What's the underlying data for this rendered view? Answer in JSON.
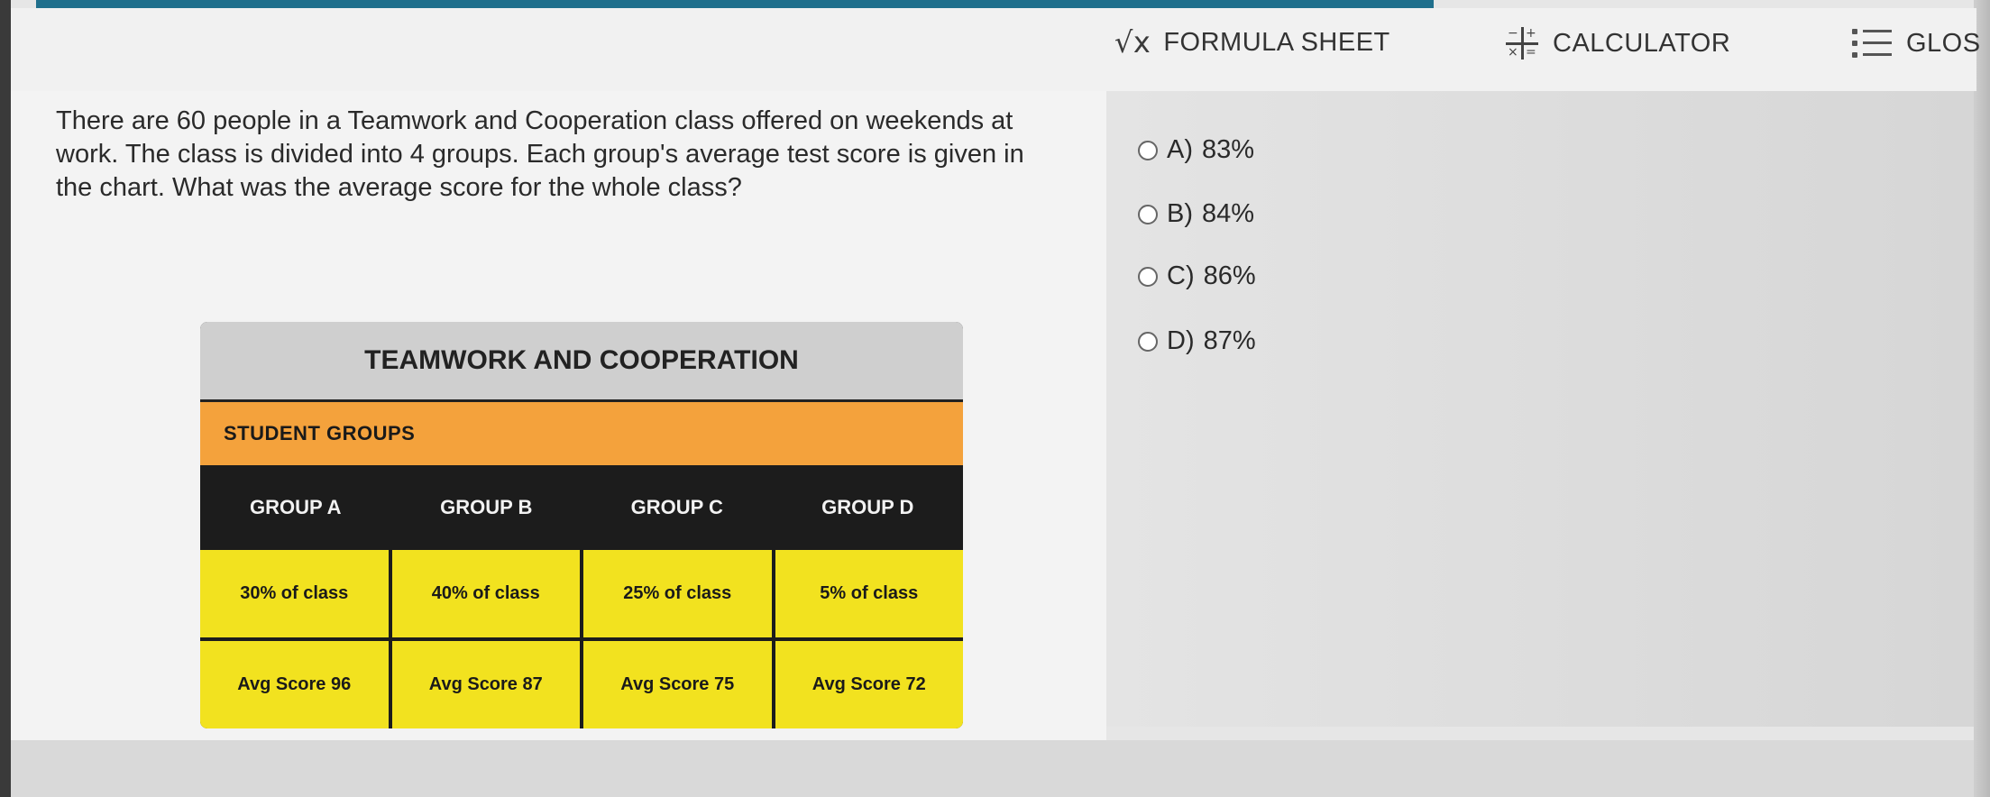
{
  "toolbar": {
    "formula_label": "FORMULA SHEET",
    "calculator_label": "CALCULATOR",
    "glossary_label": "GLOS",
    "formula_icon_glyph": "√x"
  },
  "question": {
    "text": "There are 60 people in a Teamwork and Cooperation class offered on weekends at work. The class is divided into 4 groups. Each group's average test score is given in the chart. What was the average score for the whole class?"
  },
  "options": [
    {
      "letter": "A)",
      "text": "83%"
    },
    {
      "letter": "B)",
      "text": "84%"
    },
    {
      "letter": "C)",
      "text": "86%"
    },
    {
      "letter": "D)",
      "text": "87%"
    }
  ],
  "table": {
    "title": "TEAMWORK AND COOPERATION",
    "subtitle": "STUDENT GROUPS",
    "headers": [
      "GROUP A",
      "GROUP B",
      "GROUP C",
      "GROUP D"
    ],
    "shares": [
      "30% of class",
      "40% of class",
      "25% of class",
      "5% of class"
    ],
    "scores": [
      "Avg Score 96",
      "Avg Score 87",
      "Avg Score 75",
      "Avg Score 72"
    ]
  },
  "colors": {
    "accent_bar": "#1f6f8c",
    "table_title_bg": "#cfcfcf",
    "groups_bg": "#f4a23c",
    "header_bg": "#1c1c1c",
    "cell_bg": "#f2e21f"
  }
}
